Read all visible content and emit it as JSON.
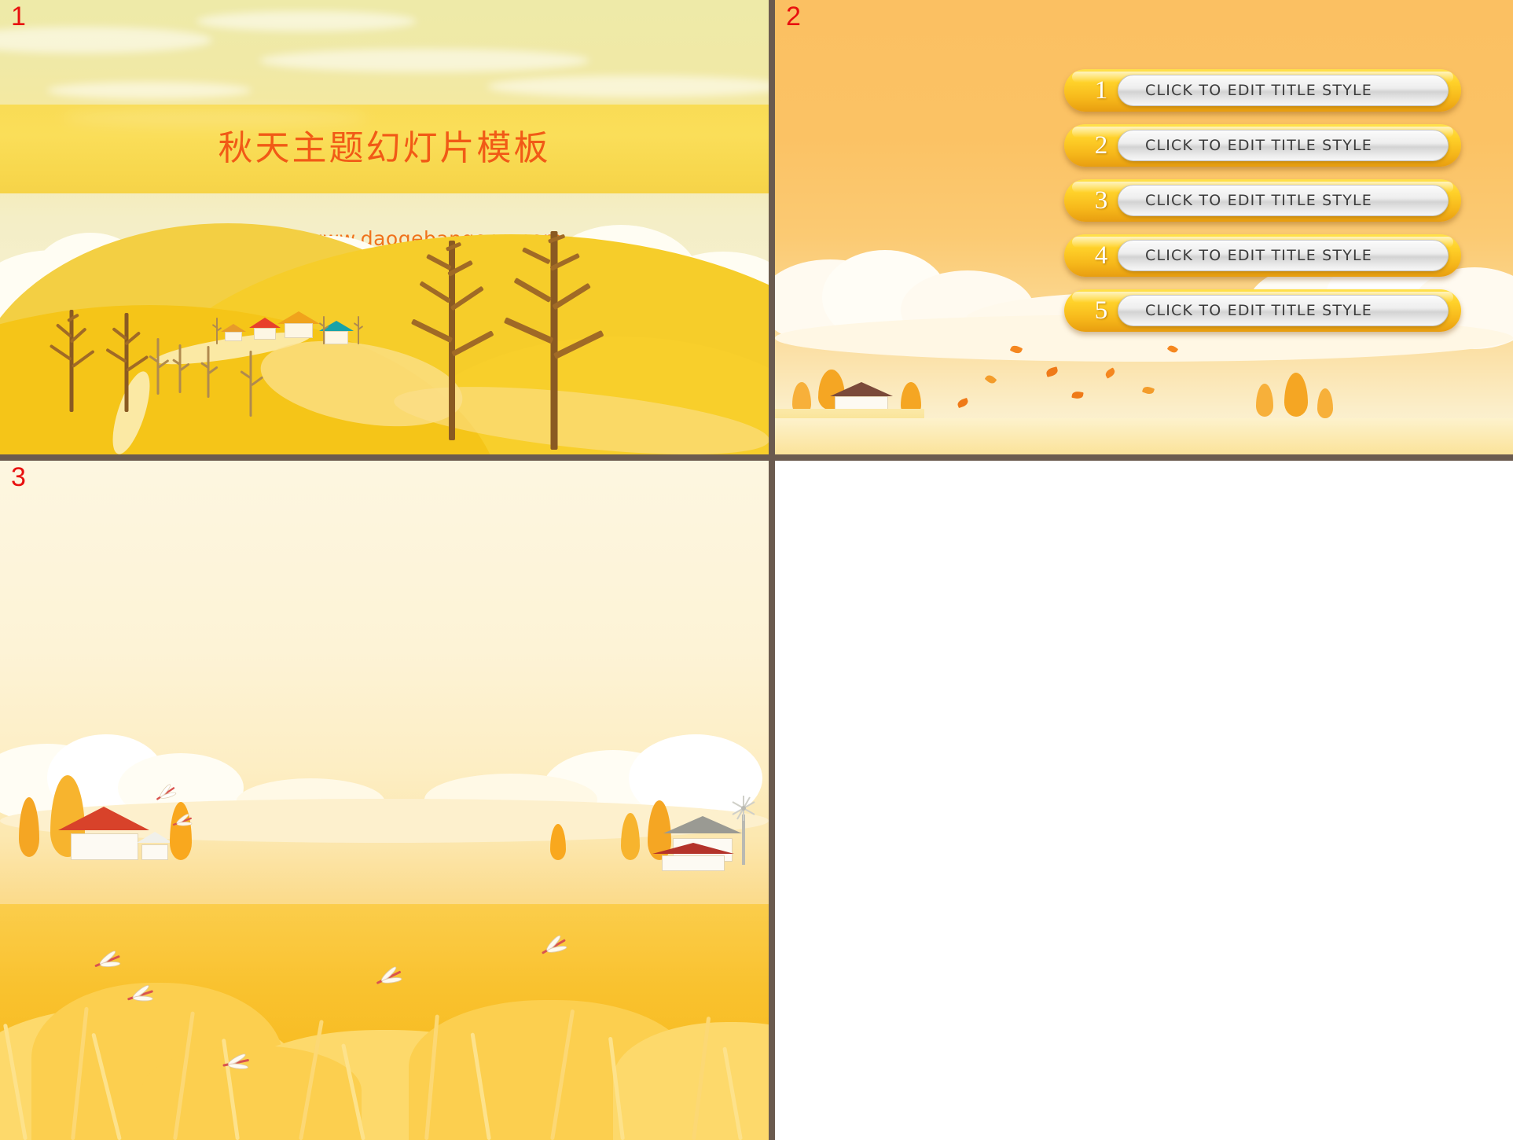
{
  "deck": {
    "title": "秋天主题幻灯片模板",
    "subtitle": "道格办公，www.daogebangong.com",
    "accent_color": "#f15a16",
    "band_color": "#f9dc55",
    "slide_number_color": "#e8100f"
  },
  "slides": [
    {
      "number": "1",
      "name": "title-slide",
      "title": "秋天主题幻灯片模板",
      "subtitle": "道格办公，www.daogebangong.com",
      "scene": "autumn countryside with bare trees, rolling yellow hills, small village houses and clouds"
    },
    {
      "number": "2",
      "name": "agenda-slide",
      "scene": "orange sky with clouds, farmhouse, falling leaves and autumn trees",
      "items": [
        {
          "num": "1",
          "label": "CLICK TO EDIT TITLE STYLE"
        },
        {
          "num": "2",
          "label": "CLICK TO EDIT TITLE STYLE"
        },
        {
          "num": "3",
          "label": "CLICK TO EDIT TITLE STYLE"
        },
        {
          "num": "4",
          "label": "CLICK TO EDIT TITLE STYLE"
        },
        {
          "num": "5",
          "label": "CLICK TO EDIT TITLE STYLE"
        }
      ]
    },
    {
      "number": "3",
      "name": "content-slide",
      "scene": "golden wheat field with dragonflies, farmhouses, autumn trees and a windmill"
    },
    {
      "number": "",
      "name": "blank-slide",
      "scene": "blank white area"
    }
  ]
}
